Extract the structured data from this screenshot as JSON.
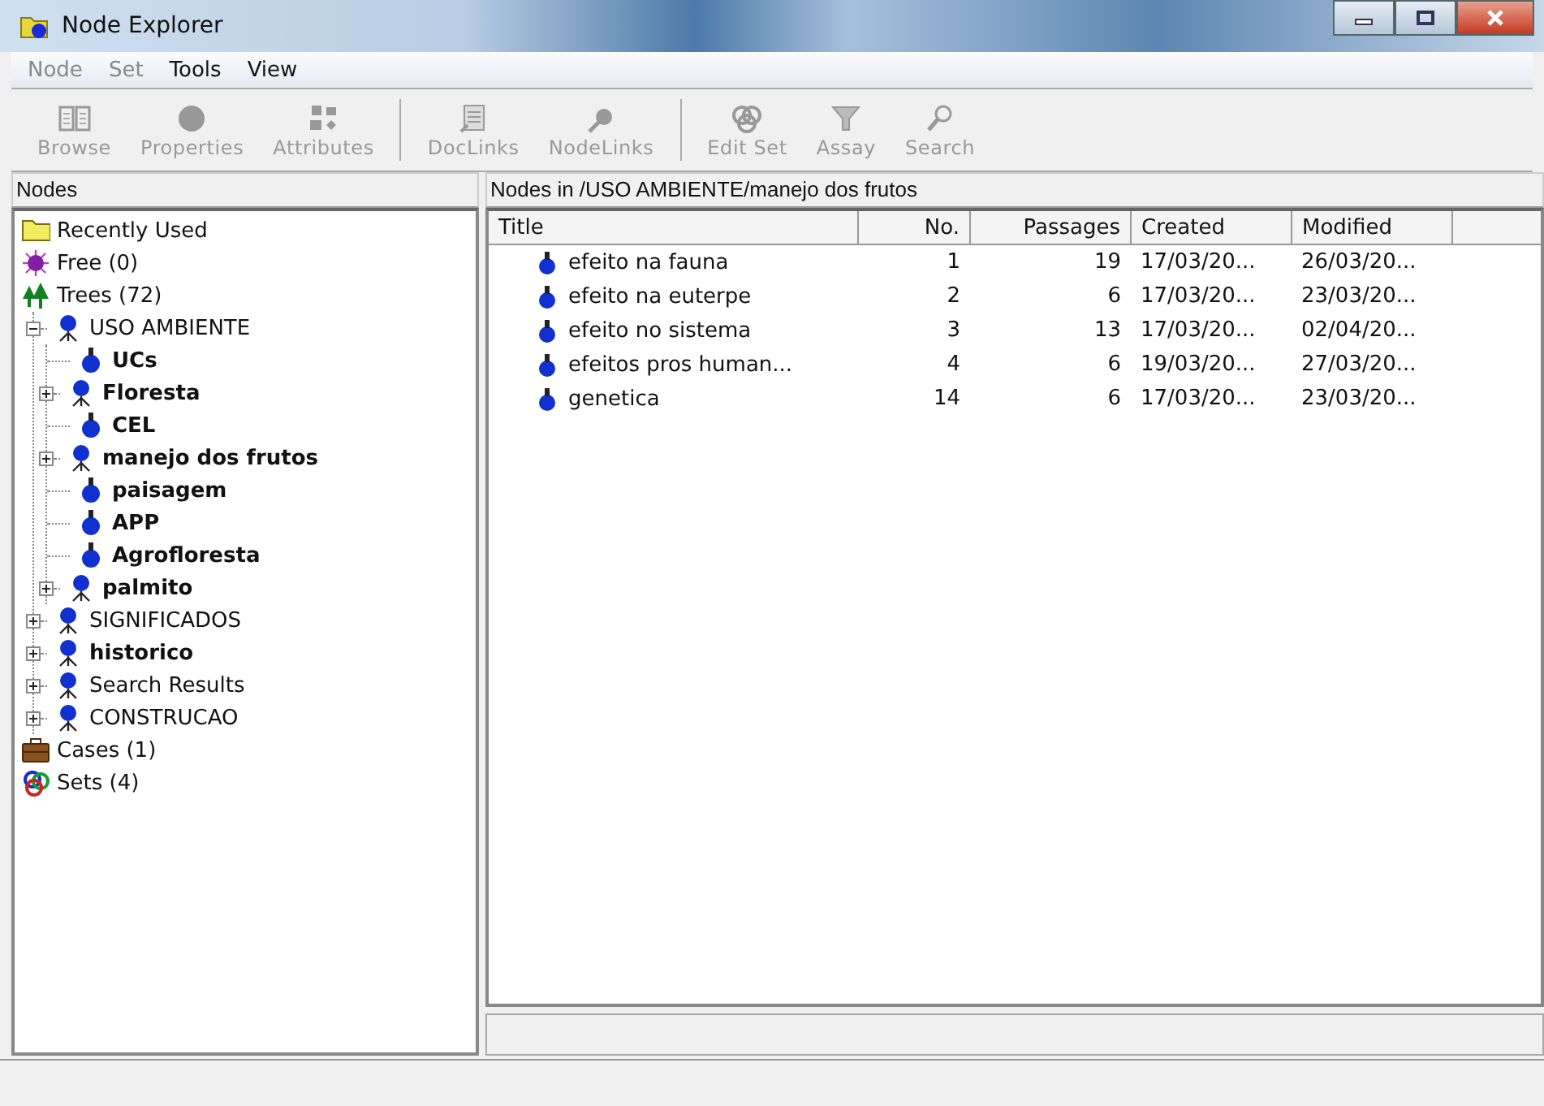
{
  "window": {
    "title": "Node Explorer"
  },
  "menu": [
    {
      "label": "Node",
      "disabled": true
    },
    {
      "label": "Set",
      "disabled": true
    },
    {
      "label": "Tools",
      "disabled": false
    },
    {
      "label": "View",
      "disabled": false
    }
  ],
  "toolbar": [
    {
      "label": "Browse",
      "kind": "browse",
      "disabled": true
    },
    {
      "label": "Properties",
      "kind": "properties",
      "disabled": true
    },
    {
      "label": "Attributes",
      "kind": "attributes",
      "disabled": true
    },
    {
      "kind": "separator"
    },
    {
      "label": "DocLinks",
      "kind": "doclinks",
      "disabled": true
    },
    {
      "label": "NodeLinks",
      "kind": "nodelinks",
      "disabled": true
    },
    {
      "kind": "separator"
    },
    {
      "label": "Edit Set",
      "kind": "editset",
      "disabled": true
    },
    {
      "label": "Assay",
      "kind": "assay",
      "disabled": true
    },
    {
      "label": "Search",
      "kind": "search",
      "disabled": true
    }
  ],
  "nodes_panel": {
    "title": "Nodes",
    "tree": [
      {
        "label": "Recently Used",
        "kind": "folder",
        "bold": false
      },
      {
        "label": "Free (0)",
        "kind": "free",
        "bold": false
      },
      {
        "label": "Trees (72)",
        "kind": "trees",
        "bold": false,
        "children": [
          {
            "label": "USO AMBIENTE",
            "kind": "branch",
            "bold": false,
            "expanded": true,
            "children": [
              {
                "label": "UCs",
                "kind": "leaf",
                "bold": true
              },
              {
                "label": "Floresta",
                "kind": "branch",
                "bold": true,
                "expanded": false
              },
              {
                "label": "CEL",
                "kind": "leaf",
                "bold": true
              },
              {
                "label": "manejo dos frutos",
                "kind": "branch",
                "bold": true,
                "expanded": false
              },
              {
                "label": "paisagem",
                "kind": "leaf",
                "bold": true
              },
              {
                "label": "APP",
                "kind": "leaf",
                "bold": true
              },
              {
                "label": "Agrofloresta",
                "kind": "leaf",
                "bold": true
              },
              {
                "label": "palmito",
                "kind": "branch",
                "bold": true,
                "expanded": false
              }
            ]
          },
          {
            "label": "SIGNIFICADOS",
            "kind": "branch",
            "bold": false,
            "expanded": false
          },
          {
            "label": "historico",
            "kind": "branch",
            "bold": true,
            "expanded": false
          },
          {
            "label": "Search Results",
            "kind": "branch",
            "bold": false,
            "expanded": false
          },
          {
            "label": "CONSTRUCAO",
            "kind": "branch",
            "bold": false,
            "expanded": false
          }
        ]
      },
      {
        "label": "Cases (1)",
        "kind": "cases",
        "bold": false
      },
      {
        "label": "Sets (4)",
        "kind": "sets",
        "bold": false
      }
    ]
  },
  "list_panel": {
    "title": "Nodes in /USO AMBIENTE/manejo dos frutos",
    "table": {
      "columns": [
        "Title",
        "No.",
        "Passages",
        "Created",
        "Modified"
      ],
      "rows": [
        [
          "efeito na fauna",
          "1",
          "19",
          "17/03/20...",
          "26/03/20..."
        ],
        [
          "efeito na euterpe",
          "2",
          "6",
          "17/03/20...",
          "23/03/20..."
        ],
        [
          "efeito no sistema",
          "3",
          "13",
          "17/03/20...",
          "02/04/20..."
        ],
        [
          "efeitos pros human...",
          "4",
          "6",
          "19/03/20...",
          "27/03/20..."
        ],
        [
          "genetica",
          "14",
          "6",
          "17/03/20...",
          "23/03/20..."
        ]
      ]
    }
  }
}
